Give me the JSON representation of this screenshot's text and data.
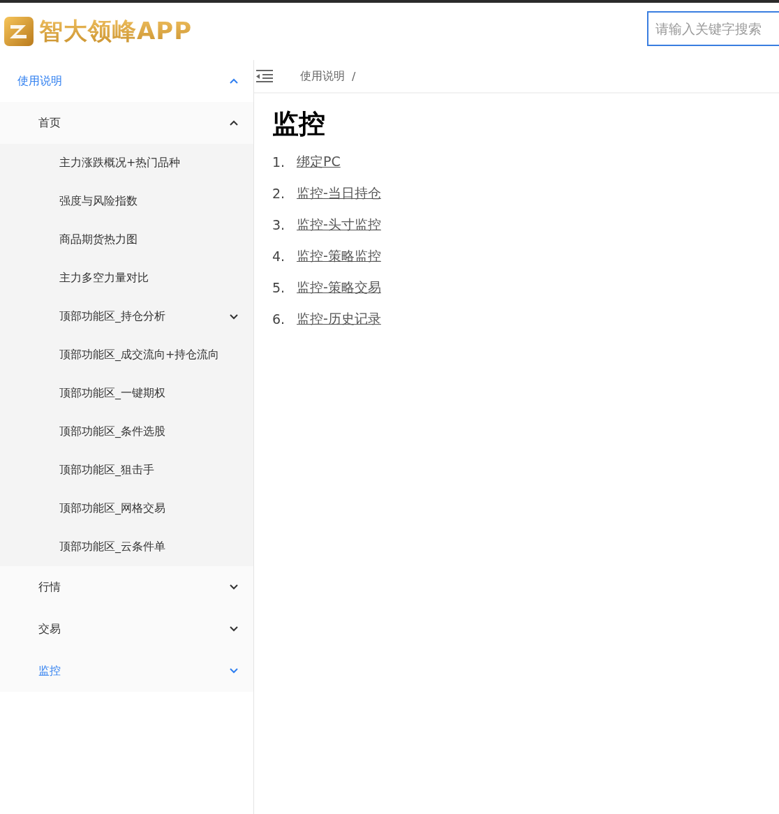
{
  "header": {
    "logo_text": "智大领峰APP",
    "search": {
      "placeholder": "请输入关键字搜索"
    }
  },
  "sidebar": {
    "items": [
      {
        "label": "使用说明",
        "selected": true,
        "expanded": true,
        "children": [
          {
            "label": "首页",
            "selected": false,
            "expanded": true,
            "children": [
              {
                "label": "主力涨跌概况+热门品种",
                "selected": false
              },
              {
                "label": "强度与风险指数",
                "selected": false
              },
              {
                "label": "商品期货热力图",
                "selected": false
              },
              {
                "label": "主力多空力量对比",
                "selected": false
              },
              {
                "label": "顶部功能区_持仓分析",
                "selected": false,
                "expanded": false
              },
              {
                "label": "顶部功能区_成交流向+持仓流向",
                "selected": false
              },
              {
                "label": "顶部功能区_一键期权",
                "selected": false
              },
              {
                "label": "顶部功能区_条件选股",
                "selected": false
              },
              {
                "label": "顶部功能区_狙击手",
                "selected": false
              },
              {
                "label": "顶部功能区_网格交易",
                "selected": false
              },
              {
                "label": "顶部功能区_云条件单",
                "selected": false
              }
            ]
          },
          {
            "label": "行情",
            "selected": false,
            "expanded": false
          },
          {
            "label": "交易",
            "selected": false,
            "expanded": false
          },
          {
            "label": "监控",
            "selected": true,
            "expanded": false
          }
        ]
      }
    ]
  },
  "breadcrumb": [
    "使用说明",
    "/"
  ],
  "content": {
    "title": "监控",
    "links": [
      {
        "number": "1.",
        "label": "绑定PC"
      },
      {
        "number": "2.",
        "label": "监控-当日持仓"
      },
      {
        "number": "3.",
        "label": "监控-头寸监控"
      },
      {
        "number": "4.",
        "label": "监控-策略监控"
      },
      {
        "number": "5.",
        "label": "监控-策略交易"
      },
      {
        "number": "6.",
        "label": "监控-历史记录"
      }
    ]
  }
}
